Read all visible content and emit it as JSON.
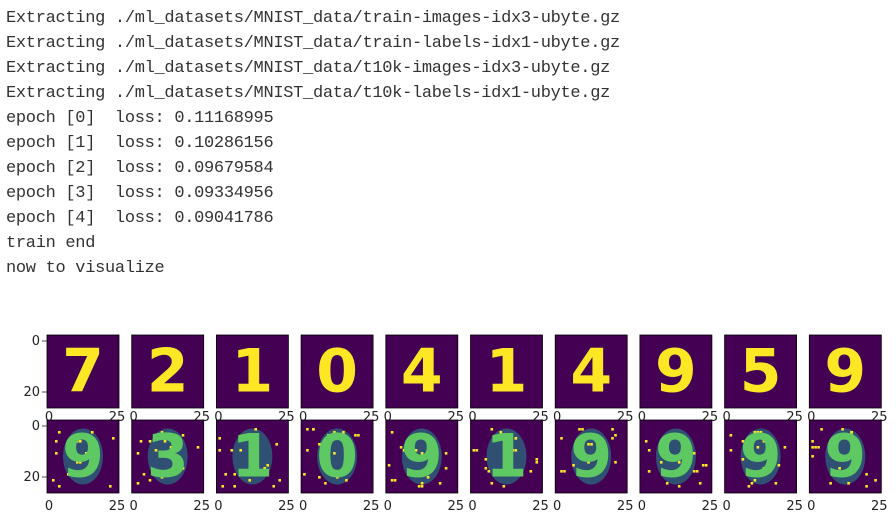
{
  "output": {
    "lines": [
      "Extracting ./ml_datasets/MNIST_data/train-images-idx3-ubyte.gz",
      "Extracting ./ml_datasets/MNIST_data/train-labels-idx1-ubyte.gz",
      "Extracting ./ml_datasets/MNIST_data/t10k-images-idx3-ubyte.gz",
      "Extracting ./ml_datasets/MNIST_data/t10k-labels-idx1-ubyte.gz",
      "epoch [0]  loss: 0.11168995",
      "epoch [1]  loss: 0.10286156",
      "epoch [2]  loss: 0.09679584",
      "epoch [3]  loss: 0.09334956",
      "epoch [4]  loss: 0.09041786",
      "train end",
      "now to visualize"
    ]
  },
  "figure": {
    "colors": {
      "background": "#440154",
      "foreground": "#fde725",
      "mid": "#21918c",
      "light": "#5ec962"
    },
    "originals": [
      "7",
      "2",
      "1",
      "0",
      "4",
      "1",
      "4",
      "9",
      "5",
      "9"
    ],
    "reconstructions": [
      "9",
      "3",
      "1",
      "0",
      "9",
      "1",
      "9",
      "9",
      "9",
      "9"
    ],
    "y_ticks": [
      "0",
      "20"
    ],
    "x_ticks": [
      "0",
      "25"
    ]
  }
}
